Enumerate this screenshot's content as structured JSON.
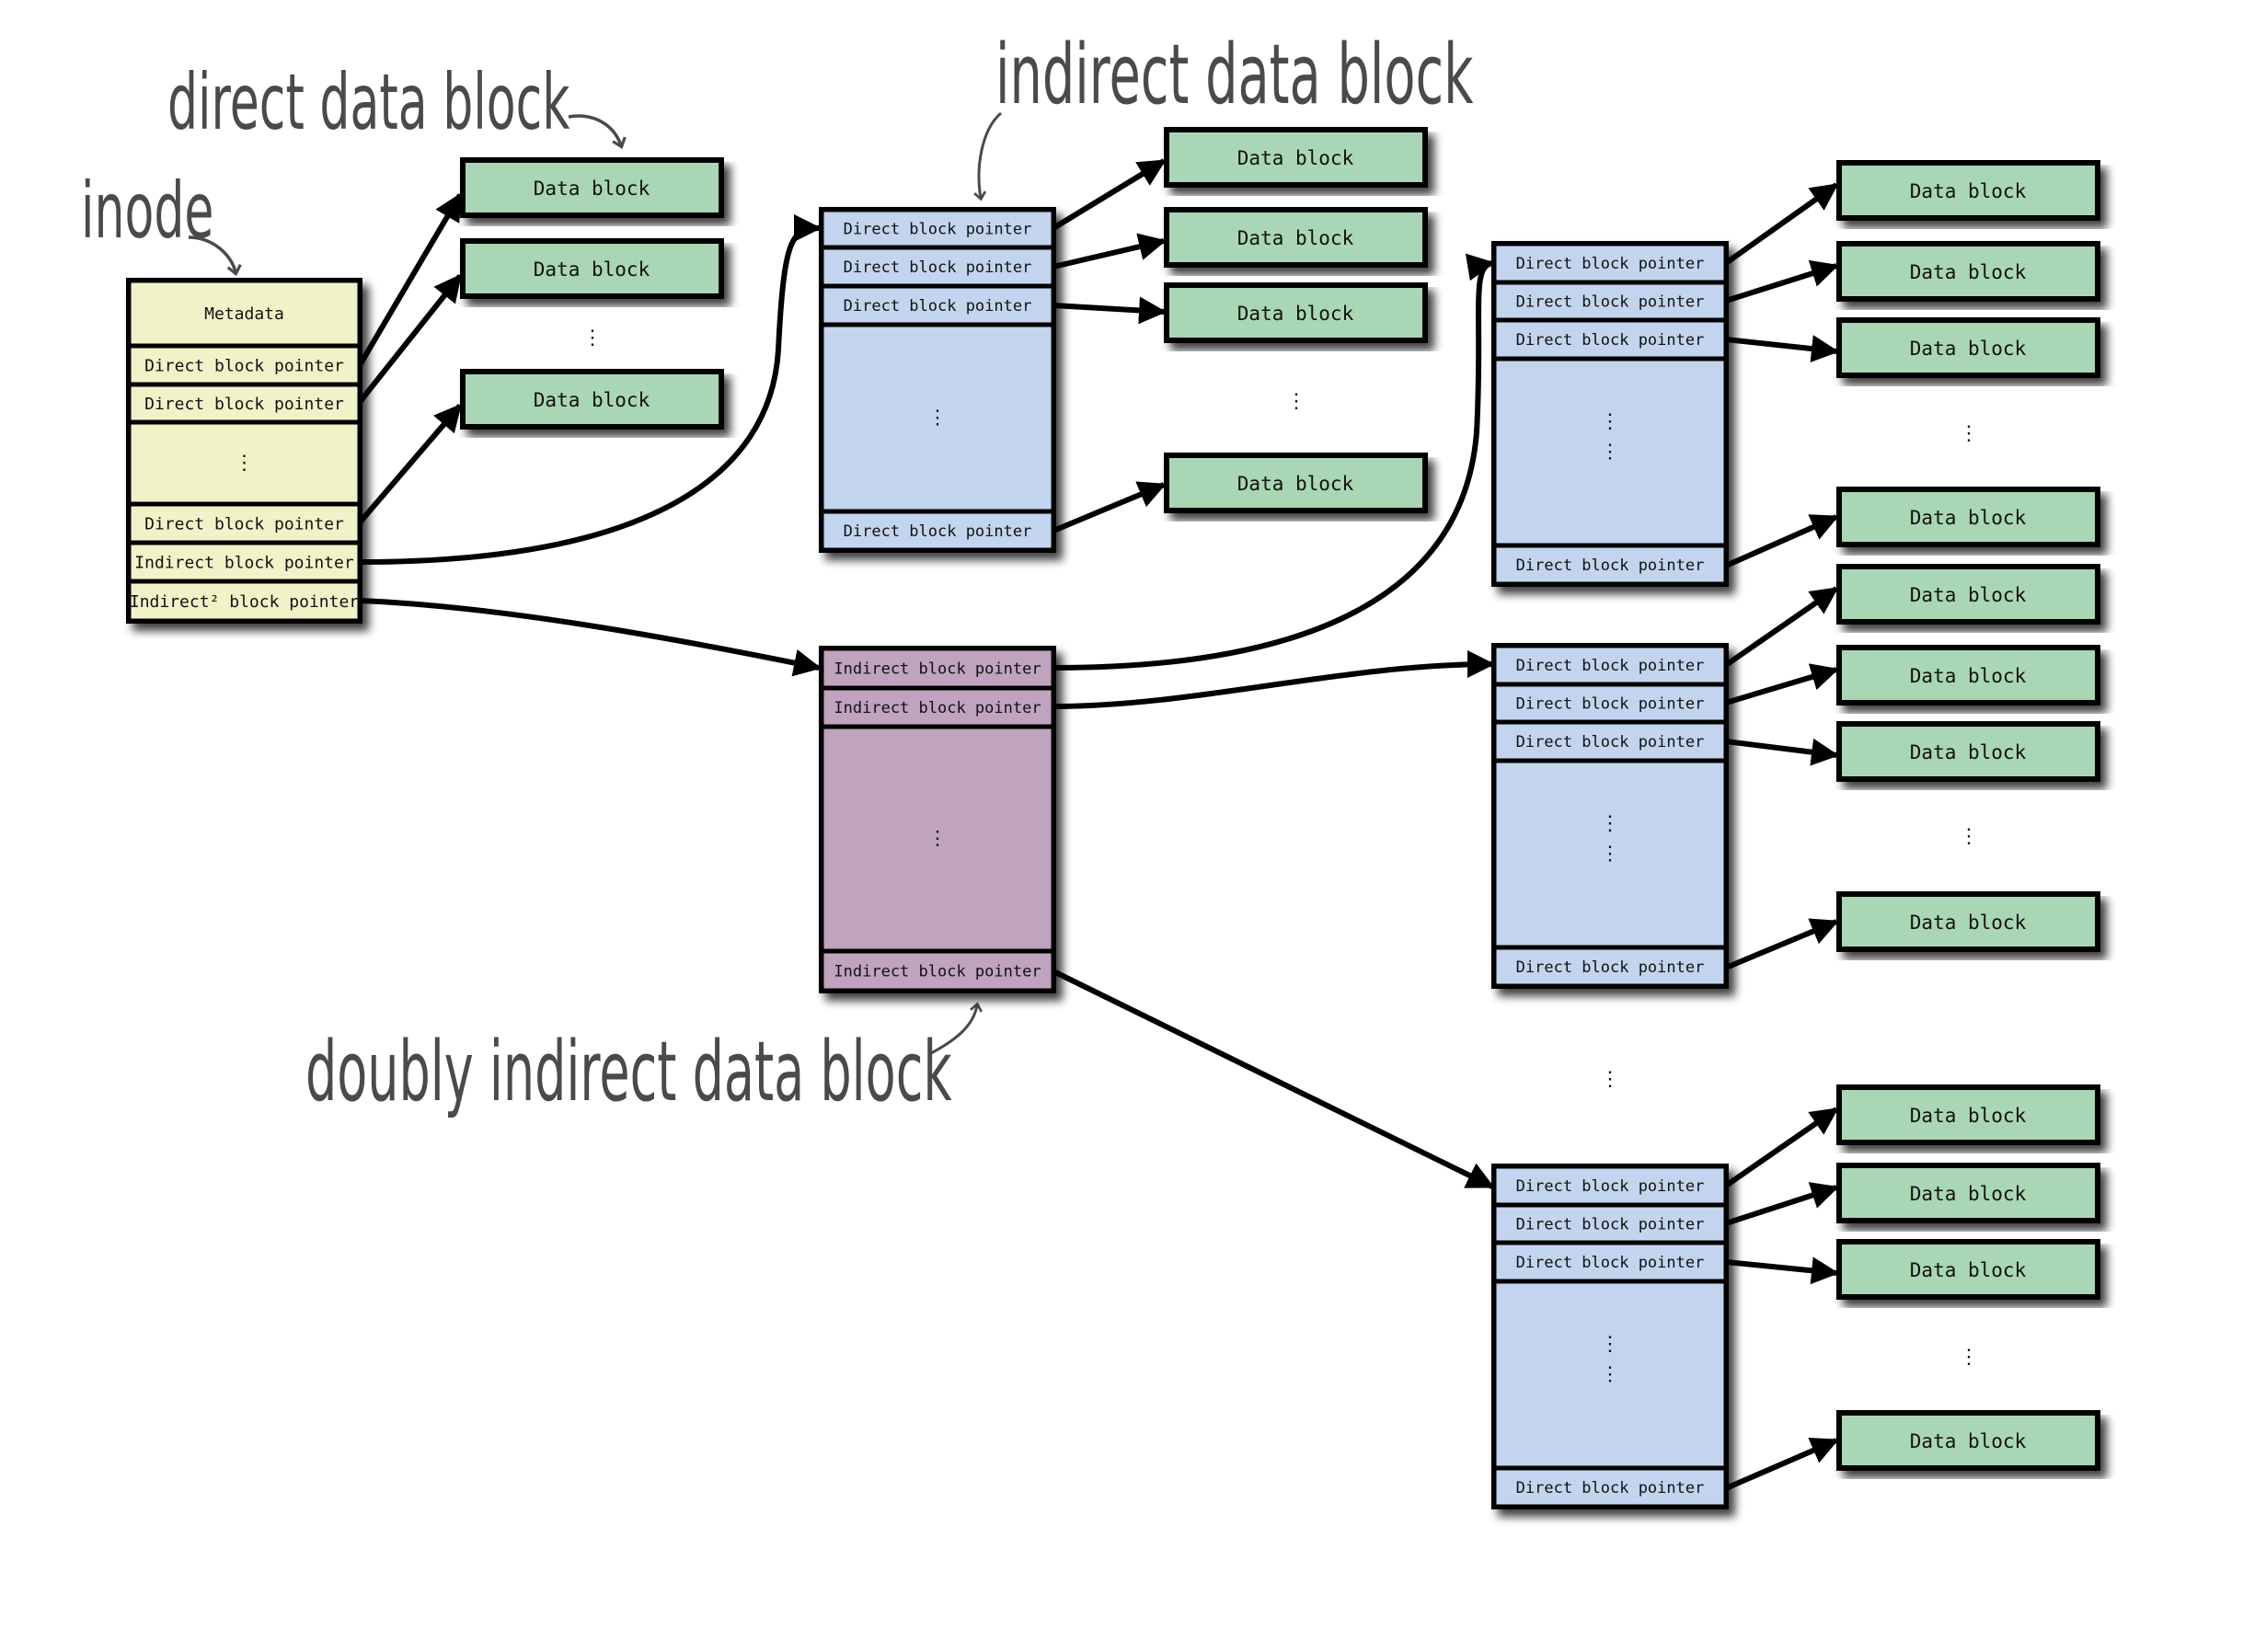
{
  "colors": {
    "inode_fill": "#f2f2c9",
    "indirect_fill": "#c3d4ee",
    "doubly_fill": "#bfa3bf",
    "data_fill": "#a9d6b5",
    "stroke": "#000000",
    "annotation": "#4a4a4a"
  },
  "annotations": {
    "inode": "inode",
    "direct": "direct data block",
    "indirect": "indirect data block",
    "doubly": "doubly indirect data block"
  },
  "inode": {
    "rows": [
      {
        "label": "Metadata",
        "kind": "meta"
      },
      {
        "label": "Direct block pointer",
        "kind": "row"
      },
      {
        "label": "Direct block pointer",
        "kind": "row"
      },
      {
        "label": "⋮",
        "kind": "ellipsis"
      },
      {
        "label": "Direct block pointer",
        "kind": "row"
      },
      {
        "label": "Indirect block pointer",
        "kind": "row"
      },
      {
        "label": "Indirect² block pointer",
        "kind": "row"
      }
    ]
  },
  "indirect_block": {
    "rows": [
      {
        "label": "Direct block pointer",
        "kind": "row"
      },
      {
        "label": "Direct block pointer",
        "kind": "row"
      },
      {
        "label": "Direct block pointer",
        "kind": "row"
      },
      {
        "label": "⋮",
        "kind": "ellipsis"
      },
      {
        "label": "Direct block pointer",
        "kind": "row"
      }
    ]
  },
  "doubly_indirect_block": {
    "rows": [
      {
        "label": "Indirect block pointer",
        "kind": "row"
      },
      {
        "label": "Indirect block pointer",
        "kind": "row"
      },
      {
        "label": "⋮",
        "kind": "ellipsis"
      },
      {
        "label": "Indirect block pointer",
        "kind": "row"
      }
    ]
  },
  "second_level_blocks": [
    {
      "rows": [
        "Direct block pointer",
        "Direct block pointer",
        "Direct block pointer",
        "⋮",
        "Direct block pointer"
      ]
    },
    {
      "rows": [
        "Direct block pointer",
        "Direct block pointer",
        "Direct block pointer",
        "⋮",
        "Direct block pointer"
      ]
    },
    {
      "rows": [
        "Direct block pointer",
        "Direct block pointer",
        "Direct block pointer",
        "⋮",
        "Direct block pointer"
      ]
    }
  ],
  "data_block_label": "Data block",
  "ellipsis": "⋮"
}
